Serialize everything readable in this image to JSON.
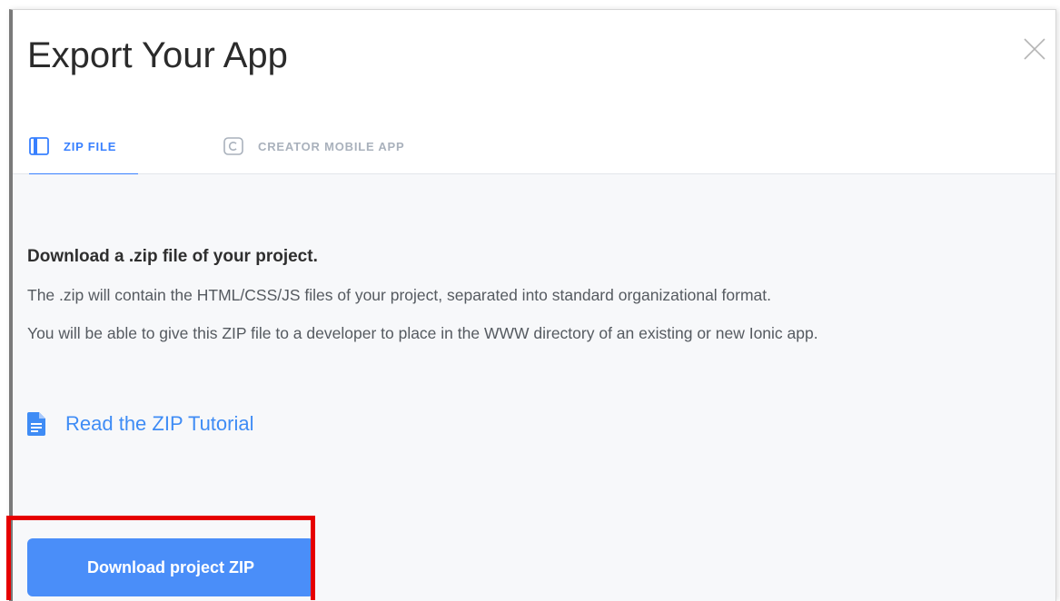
{
  "modal": {
    "title": "Export Your App",
    "close_icon": "close-icon"
  },
  "tabs": [
    {
      "label": "ZIP FILE",
      "icon": "zip-file-icon",
      "active": true
    },
    {
      "label": "CREATOR MOBILE APP",
      "icon": "creator-c-icon",
      "active": false
    }
  ],
  "content": {
    "heading": "Download a .zip file of your project.",
    "paragraph_1": "The .zip will contain the HTML/CSS/JS files of your project, separated into standard organizational format.",
    "paragraph_2": "You will be able to give this ZIP file to a developer to place in the WWW directory of an existing or new Ionic app.",
    "tutorial_link": "Read the ZIP Tutorial",
    "tutorial_icon": "document-icon",
    "download_button": "Download project ZIP"
  },
  "colors": {
    "accent": "#3880ff",
    "button": "#4a8ef9",
    "highlight": "#e60000",
    "inactive_tab": "#a9b1bc"
  }
}
